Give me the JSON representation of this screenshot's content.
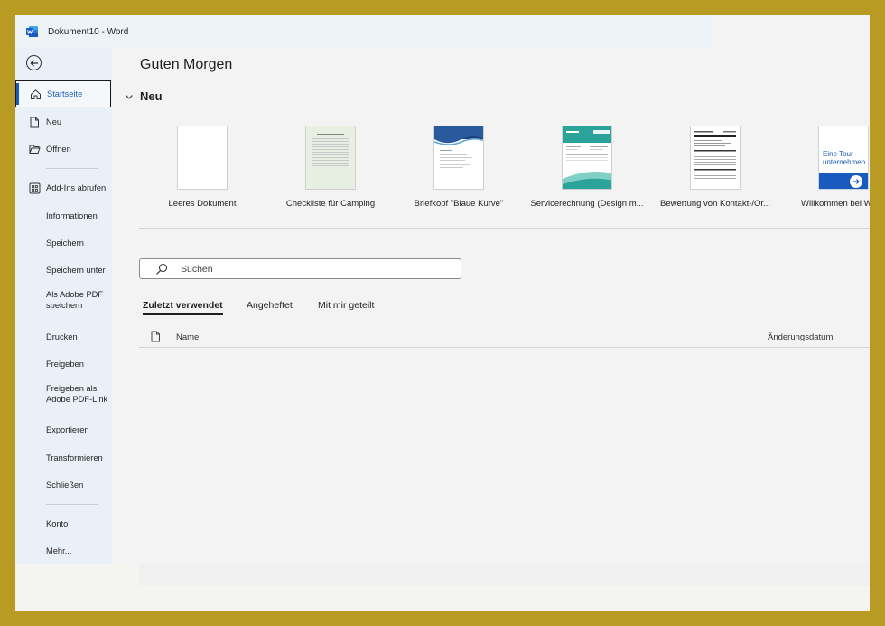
{
  "window": {
    "title": "Dokument10  -  Word"
  },
  "sidebar": {
    "items": [
      {
        "label": "Startseite"
      },
      {
        "label": "Neu"
      },
      {
        "label": "Öffnen"
      },
      {
        "label": "Add-Ins abrufen"
      },
      {
        "label": "Informationen"
      },
      {
        "label": "Speichern"
      },
      {
        "label": "Speichern unter"
      },
      {
        "label": "Als Adobe PDF speichern"
      },
      {
        "label": "Drucken"
      },
      {
        "label": "Freigeben"
      },
      {
        "label": "Freigeben als Adobe PDF-Link"
      },
      {
        "label": "Exportieren"
      },
      {
        "label": "Transformieren"
      },
      {
        "label": "Schließen"
      },
      {
        "label": "Konto"
      },
      {
        "label": "Mehr..."
      }
    ]
  },
  "main": {
    "greeting": "Guten Morgen",
    "new_section": "Neu",
    "templates": [
      {
        "caption": "Leeres Dokument"
      },
      {
        "caption": "Checkliste für Camping"
      },
      {
        "caption": "Briefkopf \"Blaue Kurve\""
      },
      {
        "caption": "Servicerechnung (Design m..."
      },
      {
        "caption": "Bewertung von Kontakt-/Or..."
      },
      {
        "caption": "Willkommen bei W",
        "thumb_text": "Eine Tour unternehmen"
      }
    ],
    "search": {
      "placeholder": "Suchen"
    },
    "tabs": [
      {
        "label": "Zuletzt verwendet",
        "active": true
      },
      {
        "label": "Angeheftet"
      },
      {
        "label": "Mit mir geteilt"
      }
    ],
    "columns": {
      "name": "Name",
      "date": "Änderungsdatum"
    }
  },
  "colors": {
    "accent": "#185abd",
    "frame": "#b99a22"
  }
}
